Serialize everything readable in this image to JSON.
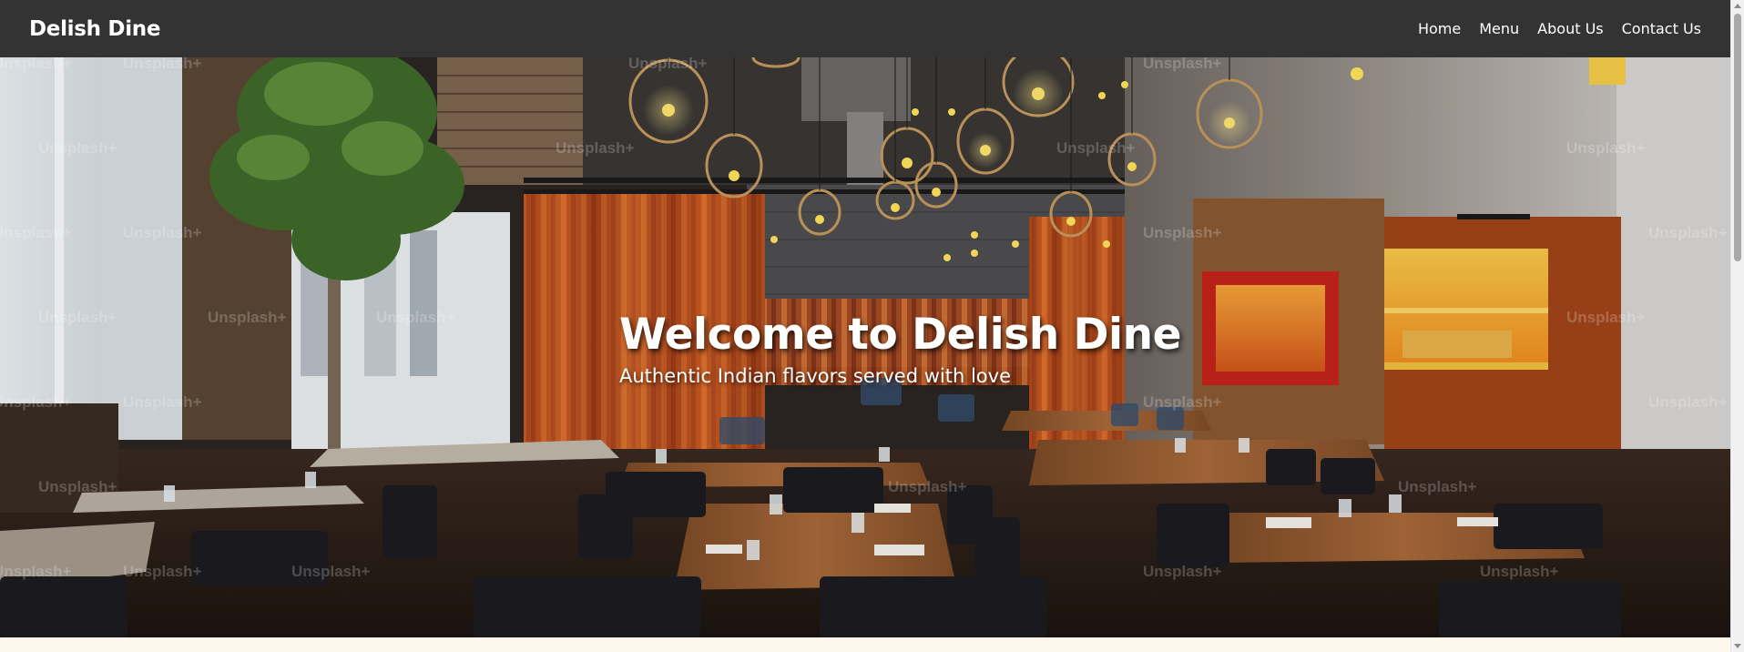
{
  "navbar": {
    "brand": "Delish Dine",
    "links": [
      "Home",
      "Menu",
      "About Us",
      "Contact Us"
    ],
    "background_color": "#333333"
  },
  "hero": {
    "title": "Welcome to Delish Dine",
    "subtitle": "Authentic Indian flavors served with love",
    "image_subject": "restaurant-interior-photo",
    "watermark": "Unsplash+"
  },
  "scrollbar": {
    "position_fraction": 0.0
  }
}
